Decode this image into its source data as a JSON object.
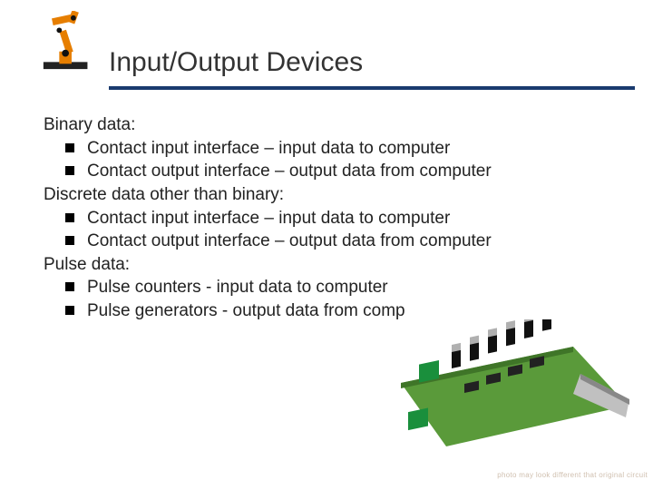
{
  "title": "Input/Output Devices",
  "sections": [
    {
      "label": "Binary data:",
      "bullets": [
        "Contact input interface – input data to computer",
        "Contact output interface – output data from computer"
      ]
    },
    {
      "label": "Discrete data other than binary:",
      "bullets": [
        "Contact input interface – input data to computer",
        "Contact output interface – output data from computer"
      ]
    },
    {
      "label": "Pulse data:",
      "bullets": [
        "Pulse counters - input data to computer",
        "Pulse generators - output data from comp"
      ]
    }
  ],
  "footnote": "photo may look different that original circuit"
}
